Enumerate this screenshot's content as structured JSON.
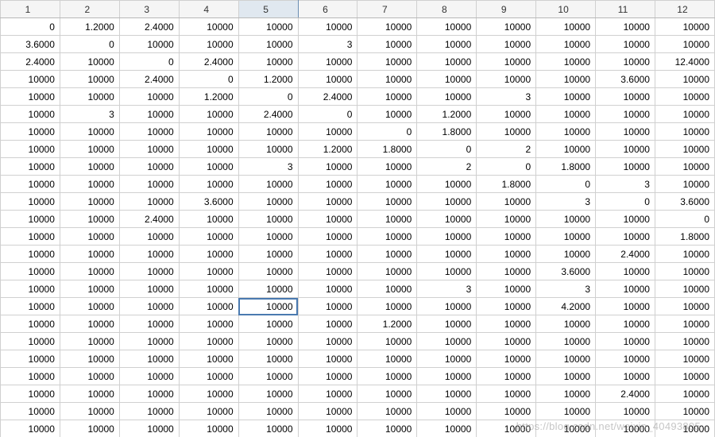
{
  "columns": [
    "1",
    "2",
    "3",
    "4",
    "5",
    "6",
    "7",
    "8",
    "9",
    "10",
    "11",
    "12"
  ],
  "selected_column_index": 4,
  "selected_cell": {
    "row": 16,
    "col": 4
  },
  "watermark": "https://blog.csdn.net/weixin_40493805",
  "rows": [
    [
      "0",
      "1.2000",
      "2.4000",
      "10000",
      "10000",
      "10000",
      "10000",
      "10000",
      "10000",
      "10000",
      "10000",
      "10000"
    ],
    [
      "3.6000",
      "0",
      "10000",
      "10000",
      "10000",
      "3",
      "10000",
      "10000",
      "10000",
      "10000",
      "10000",
      "10000"
    ],
    [
      "2.4000",
      "10000",
      "0",
      "2.4000",
      "10000",
      "10000",
      "10000",
      "10000",
      "10000",
      "10000",
      "10000",
      "12.4000"
    ],
    [
      "10000",
      "10000",
      "2.4000",
      "0",
      "1.2000",
      "10000",
      "10000",
      "10000",
      "10000",
      "10000",
      "3.6000",
      "10000"
    ],
    [
      "10000",
      "10000",
      "10000",
      "1.2000",
      "0",
      "2.4000",
      "10000",
      "10000",
      "3",
      "10000",
      "10000",
      "10000"
    ],
    [
      "10000",
      "3",
      "10000",
      "10000",
      "2.4000",
      "0",
      "10000",
      "1.2000",
      "10000",
      "10000",
      "10000",
      "10000"
    ],
    [
      "10000",
      "10000",
      "10000",
      "10000",
      "10000",
      "10000",
      "0",
      "1.8000",
      "10000",
      "10000",
      "10000",
      "10000"
    ],
    [
      "10000",
      "10000",
      "10000",
      "10000",
      "10000",
      "1.2000",
      "1.8000",
      "0",
      "2",
      "10000",
      "10000",
      "10000"
    ],
    [
      "10000",
      "10000",
      "10000",
      "10000",
      "3",
      "10000",
      "10000",
      "2",
      "0",
      "1.8000",
      "10000",
      "10000"
    ],
    [
      "10000",
      "10000",
      "10000",
      "10000",
      "10000",
      "10000",
      "10000",
      "10000",
      "1.8000",
      "0",
      "3",
      "10000"
    ],
    [
      "10000",
      "10000",
      "10000",
      "3.6000",
      "10000",
      "10000",
      "10000",
      "10000",
      "10000",
      "3",
      "0",
      "3.6000"
    ],
    [
      "10000",
      "10000",
      "2.4000",
      "10000",
      "10000",
      "10000",
      "10000",
      "10000",
      "10000",
      "10000",
      "10000",
      "0"
    ],
    [
      "10000",
      "10000",
      "10000",
      "10000",
      "10000",
      "10000",
      "10000",
      "10000",
      "10000",
      "10000",
      "10000",
      "1.8000"
    ],
    [
      "10000",
      "10000",
      "10000",
      "10000",
      "10000",
      "10000",
      "10000",
      "10000",
      "10000",
      "10000",
      "2.4000",
      "10000"
    ],
    [
      "10000",
      "10000",
      "10000",
      "10000",
      "10000",
      "10000",
      "10000",
      "10000",
      "10000",
      "3.6000",
      "10000",
      "10000"
    ],
    [
      "10000",
      "10000",
      "10000",
      "10000",
      "10000",
      "10000",
      "10000",
      "3",
      "10000",
      "3",
      "10000",
      "10000"
    ],
    [
      "10000",
      "10000",
      "10000",
      "10000",
      "10000",
      "10000",
      "10000",
      "10000",
      "10000",
      "4.2000",
      "10000",
      "10000"
    ],
    [
      "10000",
      "10000",
      "10000",
      "10000",
      "10000",
      "10000",
      "1.2000",
      "10000",
      "10000",
      "10000",
      "10000",
      "10000"
    ],
    [
      "10000",
      "10000",
      "10000",
      "10000",
      "10000",
      "10000",
      "10000",
      "10000",
      "10000",
      "10000",
      "10000",
      "10000"
    ],
    [
      "10000",
      "10000",
      "10000",
      "10000",
      "10000",
      "10000",
      "10000",
      "10000",
      "10000",
      "10000",
      "10000",
      "10000"
    ],
    [
      "10000",
      "10000",
      "10000",
      "10000",
      "10000",
      "10000",
      "10000",
      "10000",
      "10000",
      "10000",
      "10000",
      "10000"
    ],
    [
      "10000",
      "10000",
      "10000",
      "10000",
      "10000",
      "10000",
      "10000",
      "10000",
      "10000",
      "10000",
      "2.4000",
      "10000"
    ],
    [
      "10000",
      "10000",
      "10000",
      "10000",
      "10000",
      "10000",
      "10000",
      "10000",
      "10000",
      "10000",
      "10000",
      "10000"
    ],
    [
      "10000",
      "10000",
      "10000",
      "10000",
      "10000",
      "10000",
      "10000",
      "10000",
      "10000",
      "10000",
      "10000",
      "10000"
    ]
  ]
}
